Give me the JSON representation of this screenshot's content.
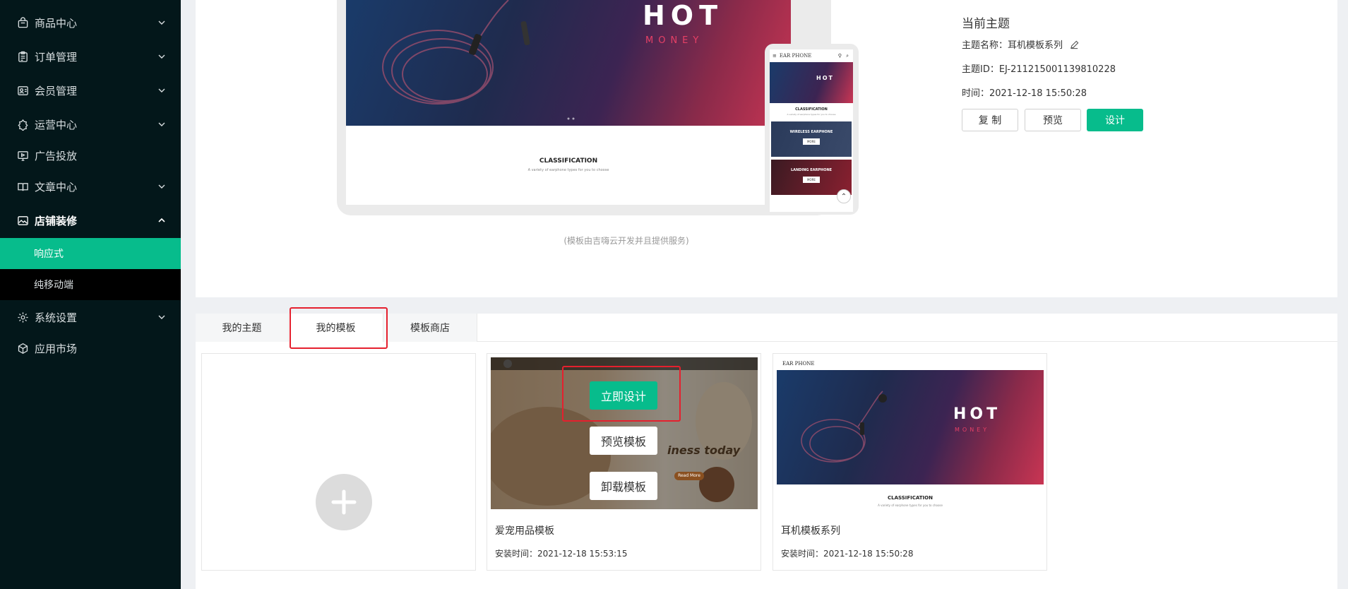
{
  "sidebar": {
    "items": [
      {
        "label": "商品中心",
        "icon": "bag-icon"
      },
      {
        "label": "订单管理",
        "icon": "clipboard-icon"
      },
      {
        "label": "会员管理",
        "icon": "member-icon"
      },
      {
        "label": "运营中心",
        "icon": "ops-icon"
      },
      {
        "label": "广告投放",
        "icon": "monitor-icon"
      },
      {
        "label": "文章中心",
        "icon": "book-icon"
      },
      {
        "label": "店铺装修",
        "icon": "image-icon"
      },
      {
        "label": "系统设置",
        "icon": "gear-icon"
      },
      {
        "label": "应用市场",
        "icon": "cube-icon"
      }
    ],
    "sub_items": [
      {
        "label": "响应式"
      },
      {
        "label": "纯移动端"
      }
    ],
    "accent": "#07bc8c",
    "bg": "#03171a"
  },
  "preview": {
    "hot": "HOT",
    "money": "MONEY",
    "classification": "CLASSIFICATION",
    "classification_sub": "A variety of earphone types for you to choose",
    "phone_brand": "EAR PHONE",
    "phone_card1": "WIRELESS EARPHONE",
    "phone_card2": "LANDING EARPHONE",
    "phone_btn": "MORE",
    "note": "(模板由吉嗨云开发并且提供服务)"
  },
  "current_theme": {
    "title": "当前主题",
    "name_line": "主题名称：耳机模板系列",
    "id_line": "主题ID：EJ-211215001139810228",
    "time_line": "时间：2021-12-18 15:50:28",
    "copy_label": "复 制",
    "preview_label": "预览",
    "design_label": "设计"
  },
  "tabs": [
    {
      "label": "我的主题"
    },
    {
      "label": "我的模板"
    },
    {
      "label": "模板商店"
    }
  ],
  "templates": [
    {
      "name": "爱宠用品模板",
      "time": "安装时间：2021-12-18 15:53:15",
      "actions": {
        "design": "立即设计",
        "preview": "预览模板",
        "uninstall": "卸载模板"
      },
      "overlay_text": "iness today",
      "cta": "Read More"
    },
    {
      "name": "耳机模板系列",
      "time": "安装时间：2021-12-18 15:50:28",
      "brand": "EAR PHONE",
      "hot": "HOT",
      "money": "MONEY",
      "classification": "CLASSIFICATION",
      "classification_sub": "A variety of earphone types for you to choose"
    }
  ]
}
